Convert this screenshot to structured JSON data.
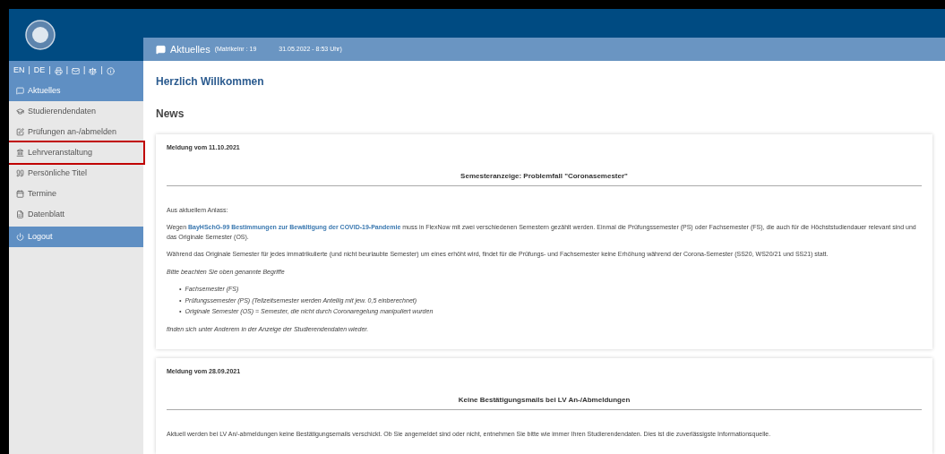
{
  "header": {
    "title": "Aktuelles",
    "matrikel": "(Matrikelnr : 19",
    "timestamp": "31.05.2022 - 8:53 Uhr)"
  },
  "language_bar": [
    {
      "kind": "text",
      "label": "EN"
    },
    {
      "kind": "sep",
      "label": "|"
    },
    {
      "kind": "text",
      "label": "DE"
    },
    {
      "kind": "sep",
      "label": "|"
    },
    {
      "kind": "print"
    },
    {
      "kind": "sep",
      "label": "|"
    },
    {
      "kind": "mail"
    },
    {
      "kind": "sep",
      "label": "|"
    },
    {
      "kind": "scale"
    },
    {
      "kind": "sep",
      "label": "|"
    },
    {
      "kind": "info"
    }
  ],
  "sidebar": {
    "items": [
      {
        "kind": "comment",
        "label": "Aktuelles",
        "selected": true,
        "highlighted": false
      },
      {
        "kind": "cap",
        "label": "Studierendendaten",
        "selected": false,
        "highlighted": false
      },
      {
        "kind": "edit",
        "label": "Prüfungen an-/abmelden",
        "selected": false,
        "highlighted": false
      },
      {
        "kind": "bank",
        "label": "Lehrveranstaltung",
        "selected": false,
        "highlighted": true
      },
      {
        "kind": "quote",
        "label": "Persönliche Titel",
        "selected": false,
        "highlighted": false
      },
      {
        "kind": "calendar",
        "label": "Termine",
        "selected": false,
        "highlighted": false
      },
      {
        "kind": "sheet",
        "label": "Datenblatt",
        "selected": false,
        "highlighted": false
      }
    ],
    "logout": "Logout"
  },
  "welcome": "Herzlich Willkommen",
  "news_heading": "News",
  "news": [
    {
      "date": "Meldung vom 11.10.2021",
      "title": "Semesteranzeige: Problemfall \"Coronasemester\"",
      "blocks": [
        {
          "kind": "p",
          "text": "Aus aktuellem Anlass:"
        },
        {
          "kind": "link_p",
          "before": "Wegen ",
          "link": "BayHSchG-99 Bestimmungen zur Bewältigung der COVID-19-Pandemie",
          "after": " muss in FlexNow mit zwei verschiedenen Semestern gezählt werden. Einmal die Prüfungssemester (PS) oder Fachsemester (FS), die auch für die Höchststudiendauer relevant sind und das Originale Semester (OS)."
        },
        {
          "kind": "p",
          "text": "Während das Originale Semester für jedes immatrikulierte (und nicht beurlaubte Semester) um eines erhöht wird, findet für die Prüfungs- und Fachsemester keine Erhöhung während der Corona-Semester (SS20, WS20/21 und SS21) statt."
        },
        {
          "kind": "em",
          "text": "Bitte beachten Sie oben genannte Begriffe"
        },
        {
          "kind": "list",
          "items": [
            {
              "marker": "•",
              "text": "Fachsemester (FS)"
            },
            {
              "marker": "•",
              "text": "Prüfungssemester (PS) (Teilzeitsemester werden Anteilig mit jew. 0,5 einberechnet)"
            },
            {
              "marker": "•",
              "text": "Originale Semester (OS) = Semester, die nicht durch Coronaregelung manipuliert wurden"
            }
          ]
        },
        {
          "kind": "em",
          "text": "finden sich unter Anderem in der Anzeige der Studierendendaten wieder."
        }
      ]
    },
    {
      "date": "Meldung vom 28.09.2021",
      "title": "Keine Bestätigungsmails bei LV An-/Abmeldungen",
      "blocks": [
        {
          "kind": "p",
          "text": "Aktuell werden bei LV An/-abmeldungen keine Bestätigungsemails verschickt. Ob Sie angemeldet sind oder nicht, entnehmen Sie bitte wie immer Ihren Studierendendaten. Dies ist die zuverlässigste Informationsquelle."
        }
      ]
    }
  ]
}
